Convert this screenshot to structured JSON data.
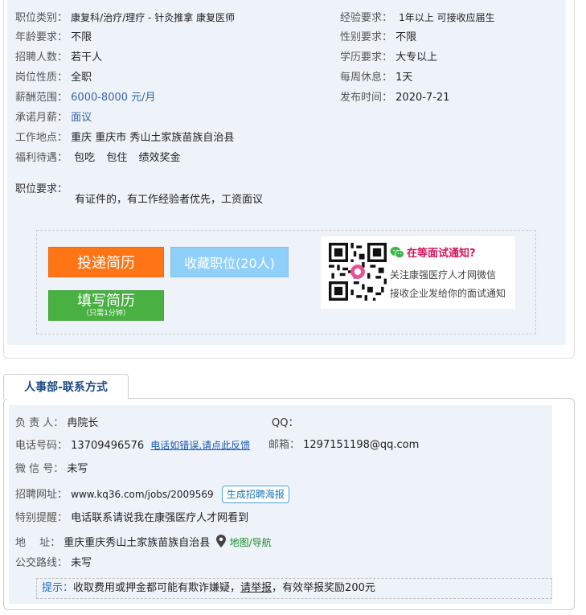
{
  "job": {
    "category_label": "职位类别：",
    "category_value": "康复科/治疗/理疗 - 针灸推拿 康复医师",
    "experience_label": "经验要求：",
    "experience_value": "1年以上 可接收应届生",
    "age_label": "年龄要求：",
    "age_value": "不限",
    "gender_label": "性别要求：",
    "gender_value": "不限",
    "headcount_label": "招聘人数：",
    "headcount_value": "若干人",
    "education_label": "学历要求：",
    "education_value": "大专以上",
    "nature_label": "岗位性质：",
    "nature_value": "全职",
    "rest_label": "每周休息：",
    "rest_value": "1天",
    "salary_label": "薪酬范围：",
    "salary_value": "6000-8000 元/月",
    "publish_label": "发布时间：",
    "publish_value": "2020-7-21",
    "monthly_label": "承诺月薪：",
    "monthly_value": "面议",
    "location_label": "工作地点：",
    "location_value": "重庆 重庆市 秀山土家族苗族自治县",
    "welfare_label": "福利待遇：",
    "welfare_tags": [
      "包吃",
      "包住",
      "绩效奖金"
    ],
    "requirement_label": "职位要求：",
    "requirement_value": "有证件的，有工作经验者优先，工资面议"
  },
  "actions": {
    "apply_label": "投递简历",
    "favorite_label": "收藏职位(20人)",
    "fill_label": "填写简历",
    "fill_sub": "（只需1分钟）"
  },
  "wechat": {
    "title": "在等面试通知?",
    "line1": "关注康强医疗人才网微信",
    "line2": "接收企业发给你的面试通知"
  },
  "contact": {
    "tab_label": "人事部-联系方式",
    "person_label": "负 责 人：",
    "person_value": "冉院长",
    "qq_label": "QQ：",
    "phone_label": "电话号码：",
    "phone_value": "13709496576",
    "phone_feedback": "电话如错误,请点此反馈",
    "email_label": "邮箱：",
    "email_value": "1297151198@qq.com",
    "wechat_label": "微 信 号：",
    "wechat_value": "未写",
    "url_label": "招聘网址：",
    "url_value": "www.kq36.com/jobs/2009569",
    "poster_button": "生成招聘海报",
    "reminder_label": "特别提醒：",
    "reminder_value": "电话联系请说我在康强医疗人才网看到",
    "address_label": "地　 址：",
    "address_value": "重庆重庆秀山土家族苗族自治县",
    "map_link": "地图/导航",
    "bus_label": "公交路线：",
    "bus_value": "未写"
  },
  "tip": {
    "label": "提示：",
    "text1": "收取费用或押金都可能有欺诈嫌疑，",
    "report": "请举报",
    "text2": "，有效举报奖励200元"
  },
  "colors": {
    "panel_bg": "#eef3f9",
    "apply_orange": "#ff7415",
    "favorite_blue": "#8fd0fa",
    "fill_green": "#49b042",
    "tab_text": "#1c4a85",
    "wechat_title": "#d4145a"
  },
  "icons": [
    "qr-code-icon",
    "wechat-icon",
    "map-pin-icon"
  ]
}
